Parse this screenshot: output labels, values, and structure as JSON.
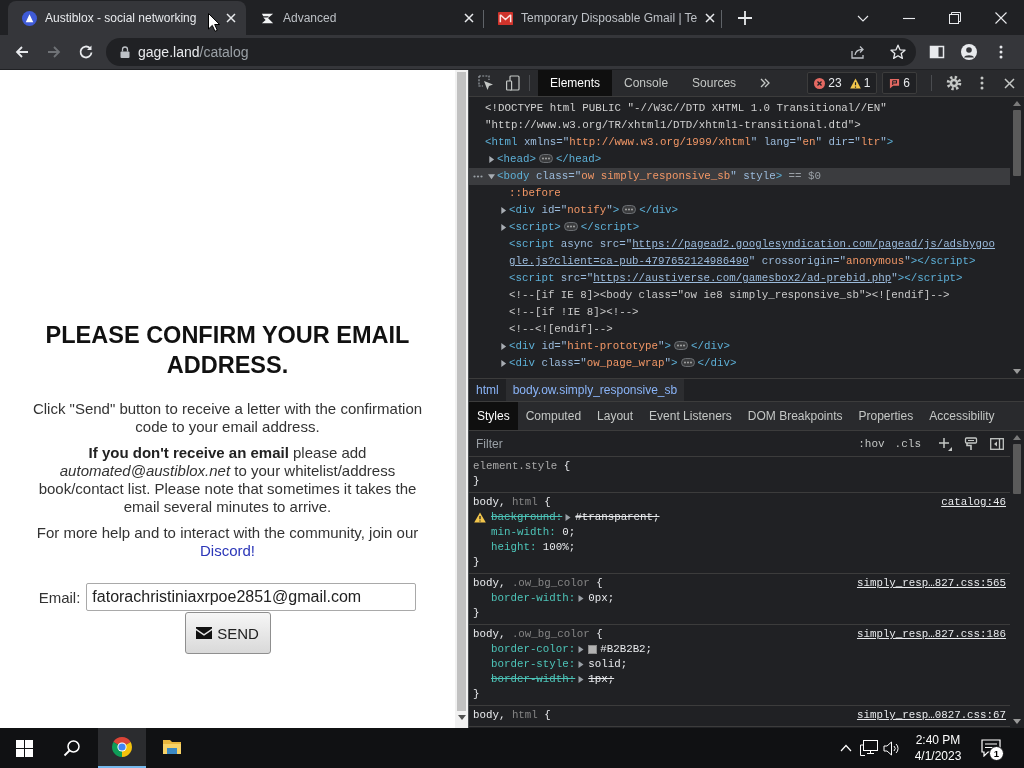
{
  "browser": {
    "tabs": [
      {
        "title": "Austiblox - social networking",
        "selected": true,
        "kind": "badge"
      },
      {
        "title": "Advanced",
        "selected": false,
        "kind": "mark"
      },
      {
        "title": "Temporary Disposable Gmail | Te",
        "selected": false,
        "kind": "mail"
      }
    ],
    "nav_buttons": [
      {
        "kind": "back",
        "disabled": false
      },
      {
        "kind": "forward",
        "disabled": true
      },
      {
        "kind": "reload",
        "disabled": false
      }
    ],
    "address": {
      "host": "gage.land",
      "path": "/catalog"
    }
  },
  "page": {
    "heading": "PLEASE CONFIRM YOUR EMAIL ADDRESS.",
    "paragraphs": [
      {
        "text": "Click \"Send\" button to receive a letter with the confirmation code to your email address."
      },
      {
        "text": "**If you don't receive an email** please add *automated@austiblox.net* to your whitelist/address book/contact list. Please note that sometimes it takes the email several minutes to arrive."
      },
      {
        "text": "For more help and to interact with the community, join our",
        "link": "Discord!"
      }
    ],
    "email": {
      "label": "Email:",
      "value": "fatorachristiniaxrpoe2851@gmail.com"
    },
    "send_button": "SEND"
  },
  "devtools": {
    "tabs": [
      {
        "label": "Elements",
        "selected": true
      },
      {
        "label": "Console",
        "selected": false
      },
      {
        "label": "Sources",
        "selected": false
      }
    ],
    "counter_groups": [
      [
        {
          "kind": "error",
          "count": "23"
        },
        {
          "kind": "warning",
          "count": "1"
        }
      ],
      [
        {
          "kind": "issue",
          "count": "6"
        }
      ]
    ],
    "dom": [
      {
        "selected": false,
        "tokens": [
          {
            "kind": "text",
            "text": "<!DOCTYPE html PUBLIC \"-//W3C//DTD XHTML 1.0 Transitional//EN\" \"http://www.w3.org/TR/xhtml1/DTD/xhtml1-transitional.dtd\">"
          }
        ]
      },
      {
        "selected": false,
        "tokens": [
          {
            "kind": "tag",
            "text": "<html"
          },
          {
            "kind": "attr",
            "text": " xmlns=\""
          },
          {
            "kind": "value",
            "text": "http://www.w3.org/1999/xhtml"
          },
          {
            "kind": "attr",
            "text": "\" lang=\""
          },
          {
            "kind": "value",
            "text": "en"
          },
          {
            "kind": "attr",
            "text": "\" dir=\""
          },
          {
            "kind": "value",
            "text": "ltr"
          },
          {
            "kind": "attr",
            "text": "\""
          },
          {
            "kind": "tag",
            "text": ">"
          }
        ],
        "children": [
          {
            "expanded": false,
            "selected": false,
            "tokens": [
              {
                "kind": "tag",
                "text": "<head>"
              },
              {
                "kind": "ellipsis"
              },
              {
                "kind": "tag",
                "text": "</head>"
              }
            ]
          },
          {
            "expanded": true,
            "selected": true,
            "tokens": [
              {
                "kind": "tag",
                "text": "<body"
              },
              {
                "kind": "attr",
                "text": " class=\""
              },
              {
                "kind": "value",
                "text": "ow simply_responsive_sb"
              },
              {
                "kind": "attr",
                "text": "\" style"
              },
              {
                "kind": "tag",
                "text": ">"
              },
              {
                "kind": "hint",
                "text": " == $0"
              }
            ],
            "children": [
              {
                "selected": false,
                "tokens": [
                  {
                    "kind": "pseudo",
                    "text": "::before"
                  }
                ]
              },
              {
                "expanded": false,
                "selected": false,
                "tokens": [
                  {
                    "kind": "tag",
                    "text": "<div"
                  },
                  {
                    "kind": "attr",
                    "text": " id=\""
                  },
                  {
                    "kind": "value",
                    "text": "notify"
                  },
                  {
                    "kind": "attr",
                    "text": "\""
                  },
                  {
                    "kind": "tag",
                    "text": ">"
                  },
                  {
                    "kind": "ellipsis"
                  },
                  {
                    "kind": "tag",
                    "text": "</div>"
                  }
                ]
              },
              {
                "expanded": false,
                "selected": false,
                "tokens": [
                  {
                    "kind": "tag",
                    "text": "<script>"
                  },
                  {
                    "kind": "ellipsis"
                  },
                  {
                    "kind": "tag",
                    "text": "</script>"
                  }
                ]
              },
              {
                "selected": false,
                "tokens": [
                  {
                    "kind": "tag",
                    "text": "<script"
                  },
                  {
                    "kind": "attr",
                    "text": " async src=\""
                  },
                  {
                    "kind": "link",
                    "text": "https://pagead2.googlesyndication.com/pagead/js/adsbygoogle.js?client=ca-pub-4797652124986490"
                  },
                  {
                    "kind": "attr",
                    "text": "\" crossorigin=\""
                  },
                  {
                    "kind": "value",
                    "text": "anonymous"
                  },
                  {
                    "kind": "attr",
                    "text": "\""
                  },
                  {
                    "kind": "tag",
                    "text": "></script>"
                  }
                ]
              },
              {
                "selected": false,
                "tokens": [
                  {
                    "kind": "tag",
                    "text": "<script"
                  },
                  {
                    "kind": "attr",
                    "text": " src=\""
                  },
                  {
                    "kind": "link",
                    "text": "https://austiverse.com/gamesbox2/ad-prebid.php"
                  },
                  {
                    "kind": "attr",
                    "text": "\""
                  },
                  {
                    "kind": "tag",
                    "text": "></script>"
                  }
                ]
              },
              {
                "selected": false,
                "tokens": [
                  {
                    "kind": "comment",
                    "text": "<!--[if IE 8]><body class=\"ow ie8 simply_responsive_sb\"><![endif]-->"
                  }
                ]
              },
              {
                "selected": false,
                "tokens": [
                  {
                    "kind": "comment",
                    "text": "<!--[if !IE 8]><!-->"
                  }
                ]
              },
              {
                "selected": false,
                "tokens": [
                  {
                    "kind": "comment",
                    "text": "<!--<![endif]-->"
                  }
                ]
              },
              {
                "expanded": false,
                "selected": false,
                "tokens": [
                  {
                    "kind": "tag",
                    "text": "<div"
                  },
                  {
                    "kind": "attr",
                    "text": " id=\""
                  },
                  {
                    "kind": "value",
                    "text": "hint-prototype"
                  },
                  {
                    "kind": "attr",
                    "text": "\""
                  },
                  {
                    "kind": "tag",
                    "text": ">"
                  },
                  {
                    "kind": "ellipsis"
                  },
                  {
                    "kind": "tag",
                    "text": "</div>"
                  }
                ]
              },
              {
                "expanded": false,
                "selected": false,
                "tokens": [
                  {
                    "kind": "tag",
                    "text": "<div"
                  },
                  {
                    "kind": "attr",
                    "text": " class=\""
                  },
                  {
                    "kind": "value",
                    "text": "ow_page_wrap"
                  },
                  {
                    "kind": "attr",
                    "text": "\""
                  },
                  {
                    "kind": "tag",
                    "text": ">"
                  },
                  {
                    "kind": "ellipsis"
                  },
                  {
                    "kind": "tag",
                    "text": "</div>"
                  }
                ]
              }
            ]
          }
        ]
      }
    ],
    "breadcrumbs": [
      {
        "label": "html",
        "selected": false
      },
      {
        "label": "body.ow.simply_responsive_sb",
        "selected": true
      }
    ],
    "sidebar_tabs": [
      {
        "label": "Styles",
        "selected": true
      },
      {
        "label": "Computed",
        "selected": false
      },
      {
        "label": "Layout",
        "selected": false
      },
      {
        "label": "Event Listeners",
        "selected": false
      },
      {
        "label": "DOM Breakpoints",
        "selected": false
      },
      {
        "label": "Properties",
        "selected": false
      },
      {
        "label": "Accessibility",
        "selected": false
      }
    ],
    "filter": {
      "placeholder": "Filter",
      "toggles": [
        ":hov",
        ".cls"
      ]
    },
    "rules": [
      {
        "kind": "inline",
        "selector": [
          {
            "text": "element.style",
            "matched": true
          }
        ],
        "open": "{",
        "close": "}"
      },
      {
        "kind": "rule",
        "selector": [
          {
            "text": "body,",
            "matched": true
          },
          {
            "text": "html",
            "matched": false
          }
        ],
        "open": "{",
        "source": "catalog:46",
        "declarations": [
          {
            "property": "background:",
            "value": "#transparent;",
            "struck": true,
            "warning": true,
            "expandable": true
          },
          {
            "property": "min-width:",
            "value": "0;",
            "struck": false,
            "warning": false,
            "expandable": false
          },
          {
            "property": "height:",
            "value": "100%;",
            "struck": false,
            "warning": false,
            "expandable": false
          }
        ],
        "close": "}"
      },
      {
        "kind": "rule",
        "selector": [
          {
            "text": "body,",
            "matched": true
          },
          {
            "text": ".ow_bg_color",
            "matched": false
          }
        ],
        "open": "{",
        "source": "simply_resp…827.css:565",
        "declarations": [
          {
            "property": "border-width:",
            "value": "0px;",
            "struck": false,
            "warning": false,
            "expandable": true
          }
        ],
        "close": "}"
      },
      {
        "kind": "rule",
        "selector": [
          {
            "text": "body,",
            "matched": true
          },
          {
            "text": ".ow_bg_color",
            "matched": false
          }
        ],
        "open": "{",
        "source": "simply_resp…827.css:186",
        "declarations": [
          {
            "property": "border-color:",
            "value": "#B2B2B2;",
            "color": "#b2b2b2",
            "struck": false,
            "warning": false,
            "expandable": true
          },
          {
            "property": "border-style:",
            "value": "solid;",
            "struck": false,
            "warning": false,
            "expandable": true
          },
          {
            "property": "border-width:",
            "value": "1px;",
            "struck": true,
            "warning": false,
            "expandable": true
          }
        ],
        "close": "}"
      },
      {
        "kind": "rule",
        "selector": [
          {
            "text": "body,",
            "matched": true
          },
          {
            "text": "html",
            "matched": false
          }
        ],
        "open": "{",
        "source": "simply_resp…0827.css:67"
      }
    ]
  },
  "taskbar": {
    "pinned": [
      {
        "kind": "browser",
        "selected": true
      },
      {
        "kind": "folder",
        "selected": false
      }
    ],
    "time": "2:40 PM",
    "date": "4/1/2023",
    "notification_count": "1"
  }
}
